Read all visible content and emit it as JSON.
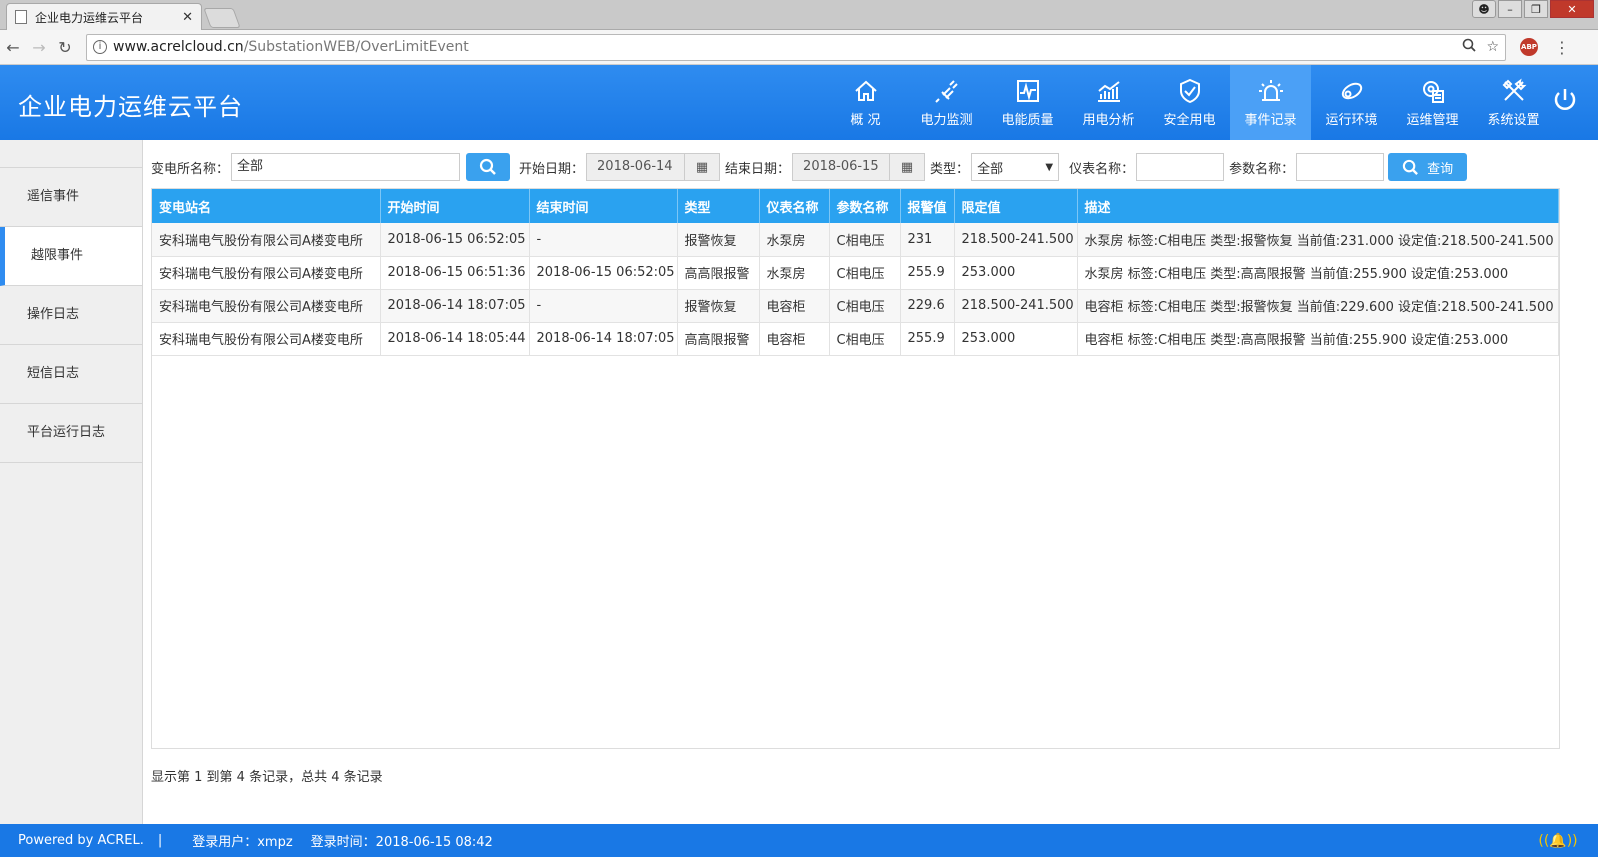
{
  "browser": {
    "tab_title": "企业电力运维云平台",
    "url_host": "www.acrelcloud.cn",
    "url_path": "/SubstationWEB/OverLimitEvent",
    "abp_label": "ABP"
  },
  "app": {
    "title": "企业电力运维云平台",
    "nav": [
      {
        "label": "概 况",
        "icon": "home-icon"
      },
      {
        "label": "电力监测",
        "icon": "plug-icon"
      },
      {
        "label": "电能质量",
        "icon": "waveform-icon"
      },
      {
        "label": "用电分析",
        "icon": "bar-chart-icon"
      },
      {
        "label": "安全用电",
        "icon": "shield-check-icon"
      },
      {
        "label": "事件记录",
        "icon": "alarm-light-icon",
        "active": true
      },
      {
        "label": "运行环境",
        "icon": "environment-icon"
      },
      {
        "label": "运维管理",
        "icon": "gear-doc-icon"
      },
      {
        "label": "系统设置",
        "icon": "tools-icon"
      }
    ],
    "active_color": "#4ba0f6",
    "header_color": "#1978e5"
  },
  "sidebar": {
    "items": [
      {
        "label": "遥信事件",
        "active": false
      },
      {
        "label": "越限事件",
        "active": true
      },
      {
        "label": "操作日志",
        "active": false
      },
      {
        "label": "短信日志",
        "active": false
      },
      {
        "label": "平台运行日志",
        "active": false
      }
    ]
  },
  "filters": {
    "substation_label": "变电所名称：",
    "substation_value": "全部",
    "start_label": "开始日期：",
    "start_value": "2018-06-14",
    "end_label": "结束日期：",
    "end_value": "2018-06-15",
    "type_label": "类型：",
    "type_value": "全部",
    "meter_label": "仪表名称：",
    "meter_value": "",
    "param_label": "参数名称：",
    "param_value": "",
    "query_label": "查询"
  },
  "table": {
    "columns": [
      "变电站名",
      "开始时间",
      "结束时间",
      "类型",
      "仪表名称",
      "参数名称",
      "报警值",
      "限定值",
      "描述"
    ],
    "rows": [
      [
        "安科瑞电气股份有限公司A楼变电所",
        "2018-06-15 06:52:05",
        "-",
        "报警恢复",
        "水泵房",
        "C相电压",
        "231",
        "218.500-241.500",
        "水泵房 标签:C相电压 类型:报警恢复 当前值:231.000 设定值:218.500-241.500"
      ],
      [
        "安科瑞电气股份有限公司A楼变电所",
        "2018-06-15 06:51:36",
        "2018-06-15 06:52:05",
        "高高限报警",
        "水泵房",
        "C相电压",
        "255.9",
        "253.000",
        "水泵房 标签:C相电压 类型:高高限报警 当前值:255.900 设定值:253.000"
      ],
      [
        "安科瑞电气股份有限公司A楼变电所",
        "2018-06-14 18:07:05",
        "-",
        "报警恢复",
        "电容柜",
        "C相电压",
        "229.6",
        "218.500-241.500",
        "电容柜 标签:C相电压 类型:报警恢复 当前值:229.600 设定值:218.500-241.500"
      ],
      [
        "安科瑞电气股份有限公司A楼变电所",
        "2018-06-14 18:05:44",
        "2018-06-14 18:07:05",
        "高高限报警",
        "电容柜",
        "C相电压",
        "255.9",
        "253.000",
        "电容柜 标签:C相电压 类型:高高限报警 当前值:255.900 设定值:253.000"
      ]
    ]
  },
  "pager": {
    "info": "显示第 1 到第 4 条记录，总共 4 条记录"
  },
  "footer": {
    "powered": "Powered by ACREL.",
    "divider": "|",
    "user_label": "登录用户：xmpz",
    "time_label": "登录时间：2018-06-15 08:42"
  }
}
